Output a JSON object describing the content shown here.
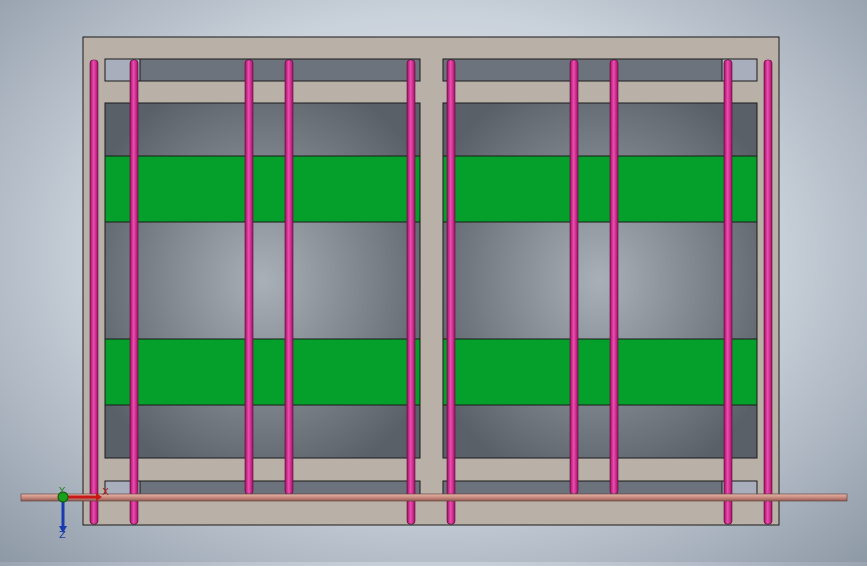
{
  "scene": {
    "description_free": true,
    "colors": {
      "frame": "#b9b0a7",
      "frame_edge": "#1a1a1a",
      "gray_panel": "#6b727b",
      "green_band": "#05a02c",
      "rod": "#c8157e",
      "rod_highlight": "#ee4eb2",
      "rail": "#c98a7e",
      "top_slot": "#6c737c",
      "small_tab": "#a8aebb"
    }
  },
  "triad": {
    "x_label": "X",
    "y_label": "Y",
    "z_label": "Z",
    "x_color": "#c81818",
    "y_color": "#1aa01a",
    "z_color": "#1a3ab0"
  }
}
